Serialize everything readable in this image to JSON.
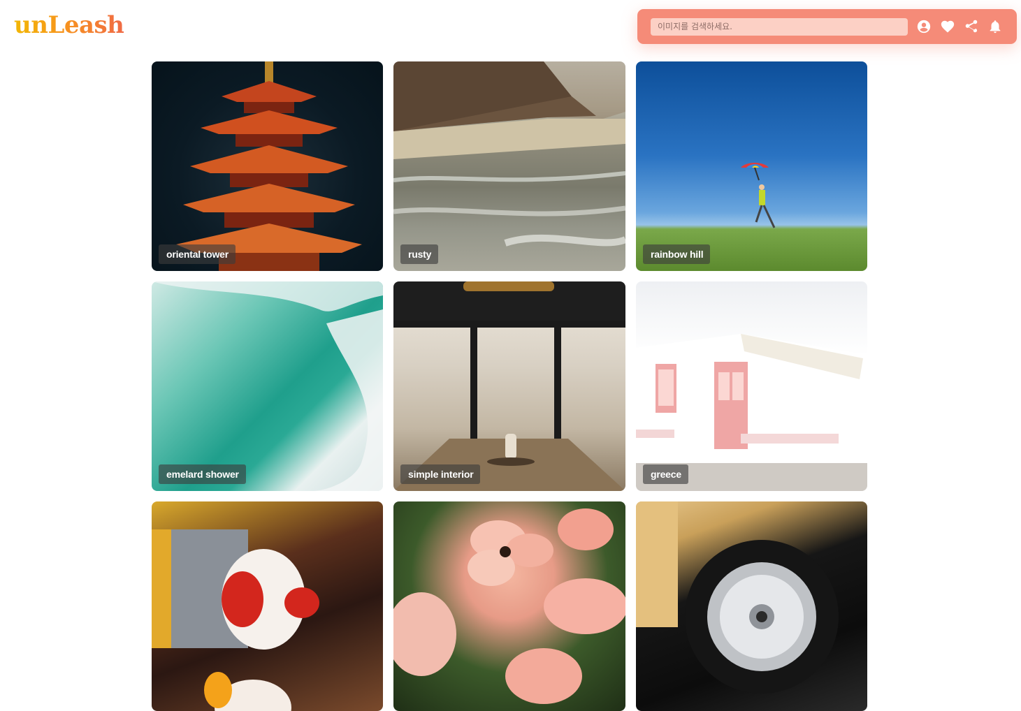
{
  "app": {
    "logo_text": "unLeash"
  },
  "header": {
    "search_placeholder": "이미지를 검색하세요.",
    "icons": [
      "user-circle-icon",
      "heart-icon",
      "share-icon",
      "bell-icon"
    ],
    "bar_color": "#f58b78",
    "search_bg_color": "#fcd0c5"
  },
  "gallery": {
    "items": [
      {
        "title": "oriental tower"
      },
      {
        "title": "rusty"
      },
      {
        "title": "rainbow hill"
      },
      {
        "title": "emelard shower"
      },
      {
        "title": "simple interior"
      },
      {
        "title": "greece"
      },
      {
        "title": ""
      },
      {
        "title": ""
      },
      {
        "title": ""
      }
    ]
  }
}
